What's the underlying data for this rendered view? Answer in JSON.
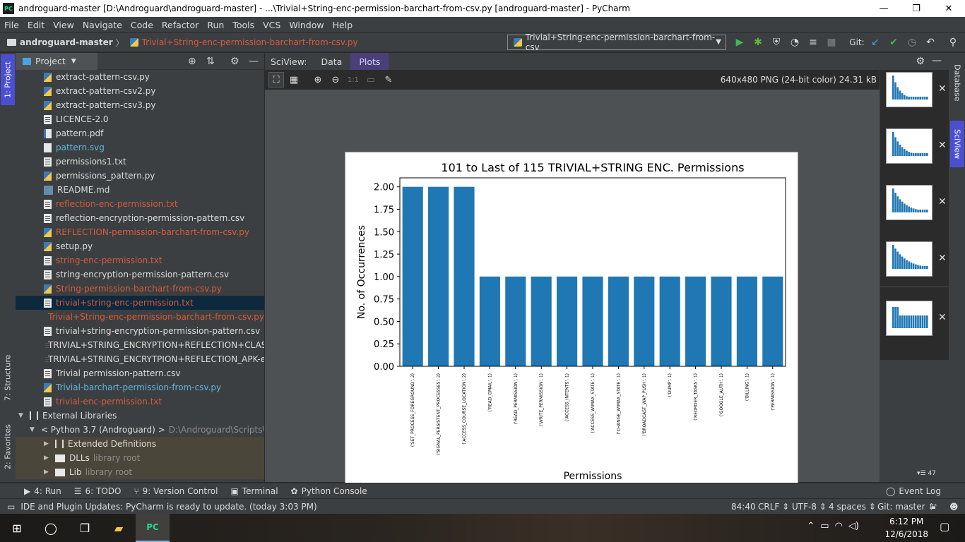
{
  "window": {
    "title": "androguard-master [D:\\Androguard\\androguard-master] - ...\\Trivial+String-enc-permission-barchart-from-csv.py [androguard-master] - PyCharm",
    "app_icon_text": "PC",
    "minimize": "—",
    "maximize": "❐",
    "close": "✕"
  },
  "menu": [
    "File",
    "Edit",
    "View",
    "Navigate",
    "Code",
    "Refactor",
    "Run",
    "Tools",
    "VCS",
    "Window",
    "Help"
  ],
  "nav": {
    "project": "androguard-master",
    "separator": "〉",
    "file": "Trivial+String-enc-permission-barchart-from-csv.py"
  },
  "run_config": {
    "label": "Trivial+String-enc-permission-barchart-from-csv",
    "git_label": "Git:"
  },
  "left_strip": {
    "project_tab": "1: Project",
    "structure_tab": "7: Structure",
    "favorites_tab": "2: Favorites"
  },
  "project_panel": {
    "title": "Project"
  },
  "tree": [
    {
      "label": "extract-pattern-csv.py",
      "icon": "python-file-icon",
      "color": "white"
    },
    {
      "label": "extract-pattern-csv2.py",
      "icon": "python-file-icon",
      "color": "white"
    },
    {
      "label": "extract-pattern-csv3.py",
      "icon": "python-file-icon",
      "color": "white"
    },
    {
      "label": "LICENCE-2.0",
      "icon": "text-file-icon",
      "color": "white"
    },
    {
      "label": "pattern.pdf",
      "icon": "pdf-file-icon",
      "color": "white"
    },
    {
      "label": "pattern.svg",
      "icon": "svg-file-icon",
      "color": "blue"
    },
    {
      "label": "permissions1.txt",
      "icon": "text-file-icon",
      "color": "white"
    },
    {
      "label": "permissions_pattern.py",
      "icon": "python-file-icon",
      "color": "white"
    },
    {
      "label": "README.md",
      "icon": "markdown-file-icon",
      "color": "white"
    },
    {
      "label": "reflection-enc-permission.txt",
      "icon": "text-file-icon",
      "color": "red"
    },
    {
      "label": "reflection-encryption-permission-pattern.csv",
      "icon": "text-file-icon",
      "color": "white"
    },
    {
      "label": "REFLECTION-permission-barchart-from-csv.py",
      "icon": "python-file-icon",
      "color": "red"
    },
    {
      "label": "setup.py",
      "icon": "python-file-icon",
      "color": "white"
    },
    {
      "label": "string-enc-permission.txt",
      "icon": "text-file-icon",
      "color": "red"
    },
    {
      "label": "string-encryption-permission-pattern.csv",
      "icon": "text-file-icon",
      "color": "white"
    },
    {
      "label": "String-permission-barchart-from-csv.py",
      "icon": "python-file-icon",
      "color": "red"
    },
    {
      "label": "trivial+string-enc-permission.txt",
      "icon": "text-file-icon",
      "color": "red",
      "selected": true
    },
    {
      "label": "Trivial+String-enc-permission-barchart-from-csv.py",
      "icon": "python-file-icon",
      "color": "red"
    },
    {
      "label": "trivial+string-encryption-permission-pattern.csv",
      "icon": "text-file-icon",
      "color": "white"
    },
    {
      "label": "TRIVIAL+STRING_ENCRYPTION+REFLECTION+CLASS_E",
      "icon": "text-file-icon",
      "color": "white"
    },
    {
      "label": "TRIVIAL+STRING_ENCRYTPION+REFLECTION_APK-enc",
      "icon": "text-file-icon",
      "color": "white"
    },
    {
      "label": "Trivial permission-pattern.csv",
      "icon": "text-file-icon",
      "color": "white"
    },
    {
      "label": "Trivial-barchart-permission-from-csv.py",
      "icon": "python-file-icon",
      "color": "blue"
    },
    {
      "label": "trivial-enc-permission.txt",
      "icon": "text-file-icon",
      "color": "red"
    }
  ],
  "external_libraries": {
    "label": "External Libraries",
    "python": "< Python 3.7 (Androguard) >",
    "python_path": "D:\\Androguard\\Scripts\\py",
    "extended": "Extended Definitions",
    "dlls": "DLLs",
    "lib": "Lib",
    "library_root": "library root"
  },
  "sciview": {
    "label": "SciView:",
    "tabs": [
      "Data",
      "Plots"
    ],
    "active_tab": "Plots",
    "image_info": "640x480 PNG (24-bit color) 24.31 kB",
    "zoom_1to1": "1:1",
    "thumb_count": "47"
  },
  "right_strip": {
    "database": "Database",
    "sciview": "SciView"
  },
  "chart_data": {
    "type": "bar",
    "title": "101 to Last of 115 TRIVIAL+STRING ENC. Permissions",
    "xlabel": "Permissions",
    "ylabel": "No. of Occurrences",
    "ylim": [
      0,
      2.1
    ],
    "yticks": [
      "0.00",
      "0.25",
      "0.50",
      "0.75",
      "1.00",
      "1.25",
      "1.50",
      "1.75",
      "2.00"
    ],
    "categories": [
      "('SET_PROCESS_FOREGROUND', 2)",
      "('SIGNAL_PERSISTENT_PROCESSES', 2)",
      "('ACCESS_COURSE_LOCATION', 2)",
      "('READ_GMAIL', 1)",
      "('READ_PERMISSION', 1)",
      "('WRITE_PERMISSION', 1)",
      "('ACCESS_INTENTS', 1)",
      "('ACCESS_WIMAX_STATE', 1)",
      "('CHANGE_WIMAX_STATE', 1)",
      "('BROADCAST_WAP_PUSH', 1)",
      "('DUMP', 1)",
      "('REORDER_TASKS', 1)",
      "('GOOGLE_AUTH', 1)",
      "('BILLING', 1)",
      "('PERMISSION', 1)"
    ],
    "values": [
      2,
      2,
      2,
      1,
      1,
      1,
      1,
      1,
      1,
      1,
      1,
      1,
      1,
      1,
      1
    ],
    "bar_color": "#1f77b4"
  },
  "bottom_tools": [
    "4: Run",
    "6: TODO",
    "9: Version Control",
    "Terminal",
    "Python Console"
  ],
  "event_log": "Event Log",
  "status": {
    "message": "IDE and Plugin Updates: PyCharm is ready to update. (today 3:03 PM)",
    "position": "84:40",
    "line_sep": "CRLF ⇕",
    "encoding": "UTF-8 ⇕",
    "indent": "4 spaces ⇕",
    "branch": "Git: master ⇕"
  },
  "taskbar": {
    "time": "6:12 PM",
    "date": "12/6/2018"
  },
  "colors": {
    "accent_tab": "#4b3f7a",
    "selection": "#0d293e",
    "red_file": "#d65b3c",
    "blue_file": "#5fb7e0"
  }
}
